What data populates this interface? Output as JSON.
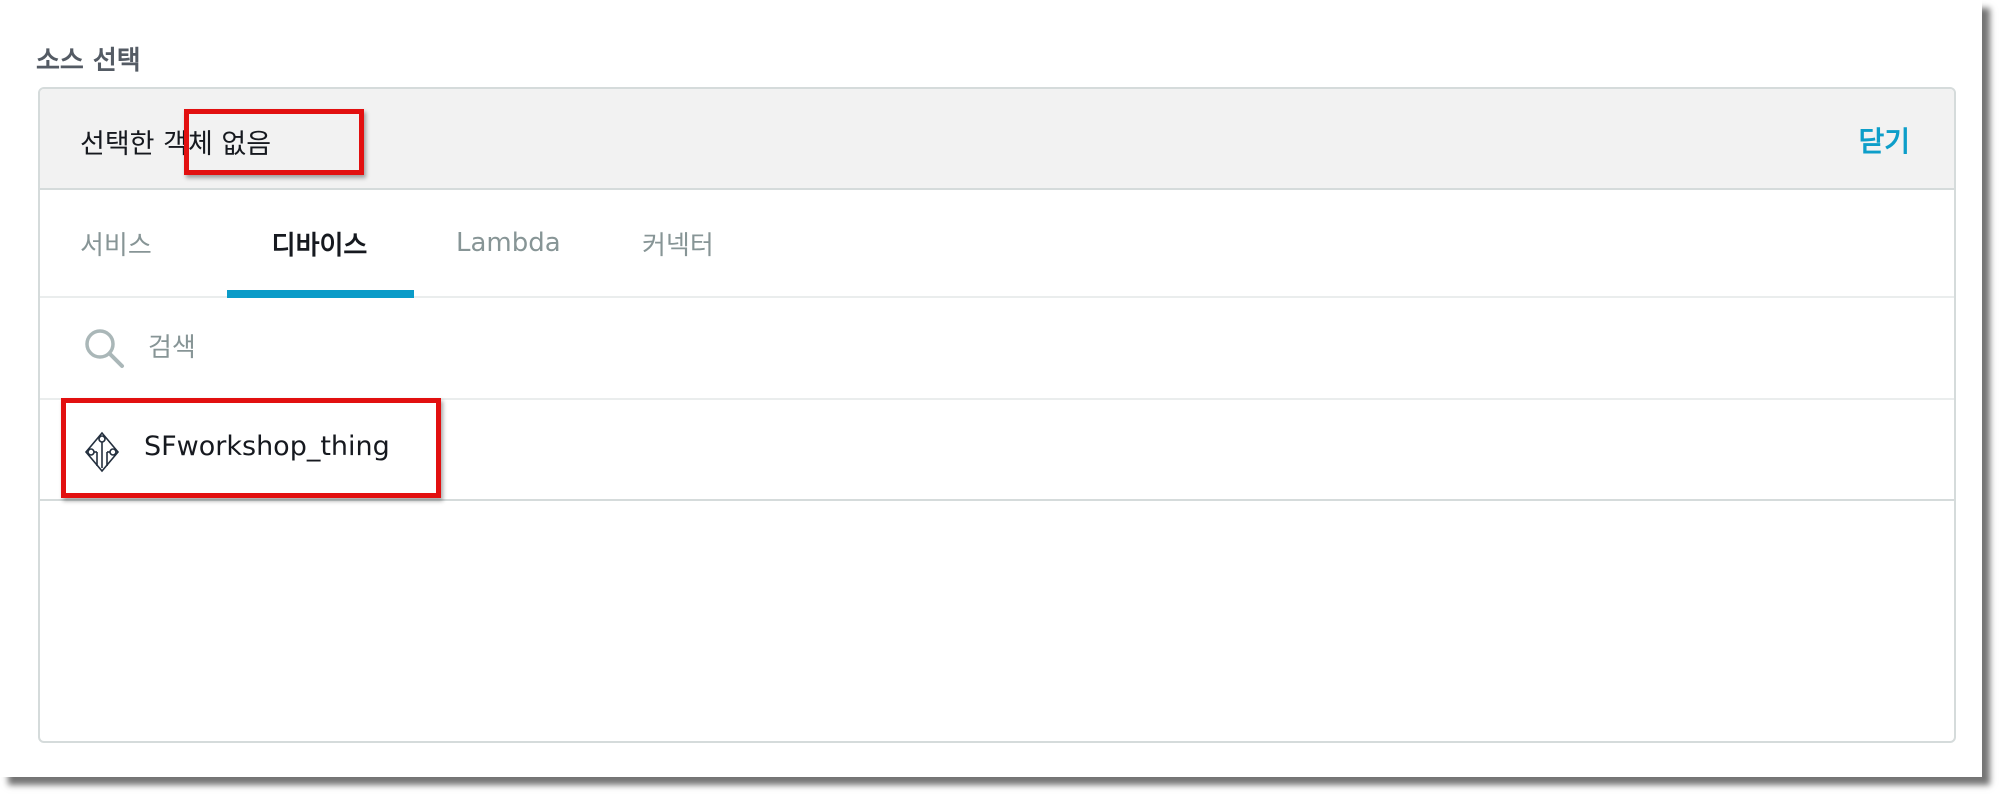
{
  "section": {
    "title": "소스 선택"
  },
  "panel": {
    "selected_text": "선택한 객체 없음",
    "close_label": "닫기"
  },
  "tabs": [
    {
      "label": "서비스",
      "active": false
    },
    {
      "label": "디바이스",
      "active": true
    },
    {
      "label": "Lambda",
      "active": false
    },
    {
      "label": "커넥터",
      "active": false
    }
  ],
  "search": {
    "placeholder": "검색",
    "value": ""
  },
  "items": [
    {
      "name": "SFworkshop_thing",
      "icon": "iot-thing-icon"
    }
  ],
  "colors": {
    "accent": "#0a9bc8",
    "link": "#0d9ec9",
    "highlight": "#e21010",
    "header_bg": "#f2f2f2"
  }
}
